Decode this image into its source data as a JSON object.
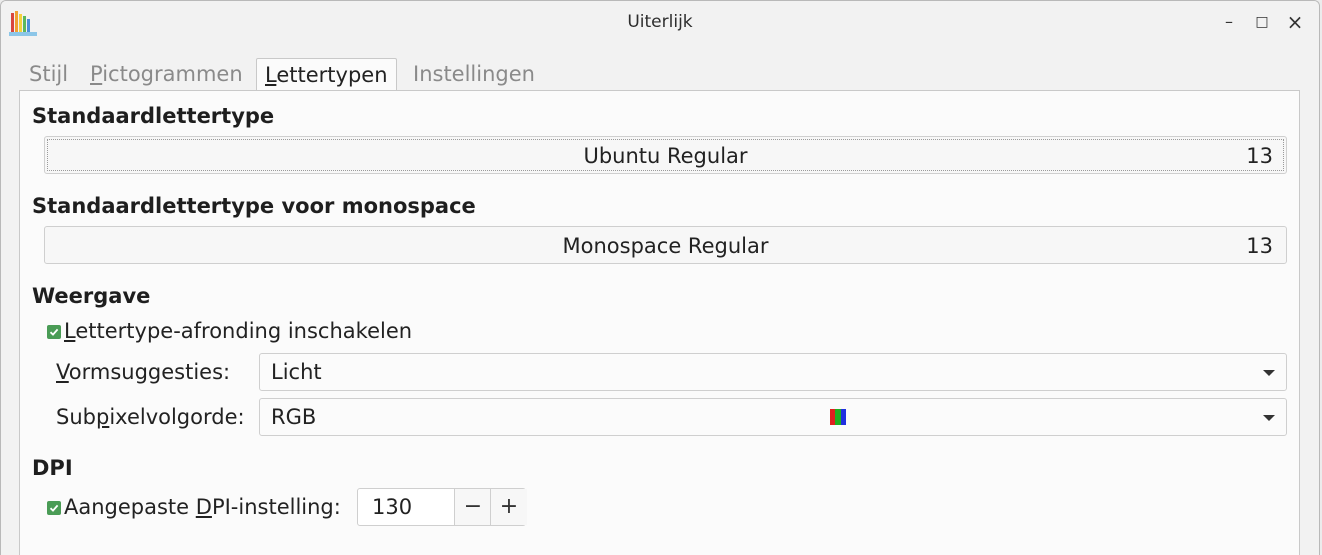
{
  "window": {
    "title": "Uiterlijk",
    "controls": {
      "minimize": "–",
      "maximize": "□",
      "close": "×"
    }
  },
  "tabs": [
    {
      "label_ul": "",
      "label_rest": "Stijl",
      "display": "Stijl"
    },
    {
      "label_ul": "P",
      "label_rest": "ictogrammen"
    },
    {
      "label_ul": "L",
      "label_rest": "ettertypen"
    },
    {
      "label_ul": "",
      "label_rest": "Instellingen"
    }
  ],
  "default_font": {
    "heading": "Standaardlettertype",
    "name": "Ubuntu Regular",
    "size": "13"
  },
  "monospace_font": {
    "heading": "Standaardlettertype voor monospace",
    "name": "Monospace Regular",
    "size": "13"
  },
  "rendering": {
    "heading": "Weergave",
    "antialias": {
      "ul": "L",
      "rest": "ettertype-afronding inschakelen",
      "checked": true
    },
    "hinting": {
      "label_ul": "V",
      "label_rest": "ormsuggesties:",
      "value": "Licht"
    },
    "subpixel": {
      "label_pre": "Sub",
      "label_ul": "p",
      "label_rest": "ixelvolgorde:",
      "value": "RGB"
    }
  },
  "dpi": {
    "heading": "DPI",
    "custom": {
      "pre": "Aangepaste ",
      "ul": "D",
      "rest": "PI-instelling:",
      "checked": true
    },
    "value": "130",
    "minus": "−",
    "plus": "+"
  },
  "colors": {
    "accent_check": "#4a9c56"
  }
}
